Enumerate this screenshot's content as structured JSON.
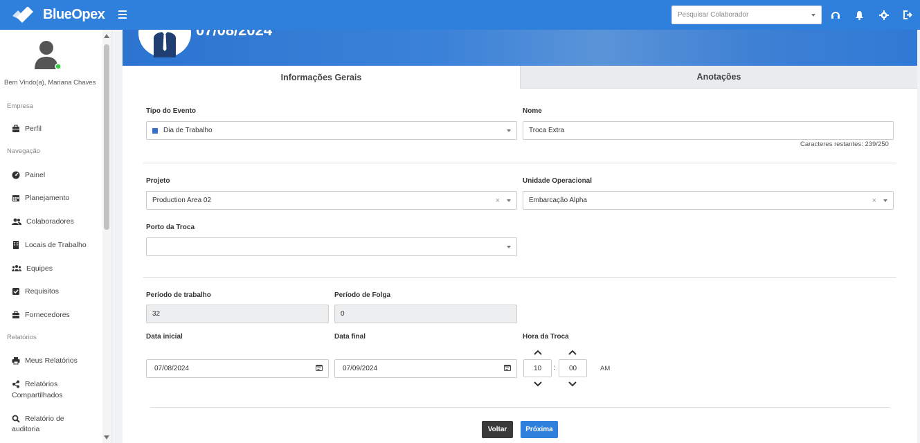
{
  "app": {
    "brand": "BlueOpex"
  },
  "topbar": {
    "search_placeholder": "Pesquisar Colaborador",
    "icons": [
      "headset-icon",
      "bell-icon",
      "gear-icon",
      "logout-icon"
    ]
  },
  "sidebar": {
    "welcome": "Bem Vindo(a), Mariana Chaves",
    "sections": {
      "empresa": "Empresa",
      "navegacao": "Navegação",
      "relatorios": "Relatórios"
    },
    "items": {
      "perfil": "Perfil",
      "painel": "Painel",
      "planejamento": "Planejamento",
      "colaboradores": "Colaboradores",
      "locais": "Locais de Trabalho",
      "equipes": "Equipes",
      "requisitos": "Requisitos",
      "fornecedores": "Fornecedores",
      "meus_relatorios": "Meus Relatórios",
      "relatorios_compartilhados_1": "Relatórios",
      "relatorios_compartilhados_2": "Compartilhados",
      "relatorio_auditoria_1": "Relatório de",
      "relatorio_auditoria_2": "auditoria"
    }
  },
  "banner": {
    "date": "07/08/2024"
  },
  "tabs": {
    "general": "Informações Gerais",
    "notes": "Anotações"
  },
  "form": {
    "tipo_evento": {
      "label": "Tipo do Evento",
      "value": "Dia de Trabalho",
      "color": "#3b6fc9"
    },
    "nome": {
      "label": "Nome",
      "value": "Troca Extra",
      "remaining": "Caracteres restantes: 239/250"
    },
    "projeto": {
      "label": "Projeto",
      "value": "Production Area 02"
    },
    "unidade": {
      "label": "Unidade Operacional",
      "value": "Embarcação Alpha"
    },
    "porto": {
      "label": "Porto da Troca",
      "value": ""
    },
    "periodo_trabalho": {
      "label": "Período de trabalho",
      "value": "32"
    },
    "periodo_folga": {
      "label": "Período de Folga",
      "value": "0"
    },
    "data_inicial": {
      "label": "Data inicial",
      "value": "07/08/2024"
    },
    "data_final": {
      "label": "Data final",
      "value": "07/09/2024"
    },
    "hora": {
      "label": "Hora da Troca",
      "hour": "10",
      "minute": "00",
      "separator": ":",
      "meridian": "AM"
    }
  },
  "buttons": {
    "back": "Voltar",
    "next": "Próxima"
  },
  "colors": {
    "primary": "#2f80dc",
    "dark_button": "#3a3a3a",
    "online": "#2ecc40"
  }
}
